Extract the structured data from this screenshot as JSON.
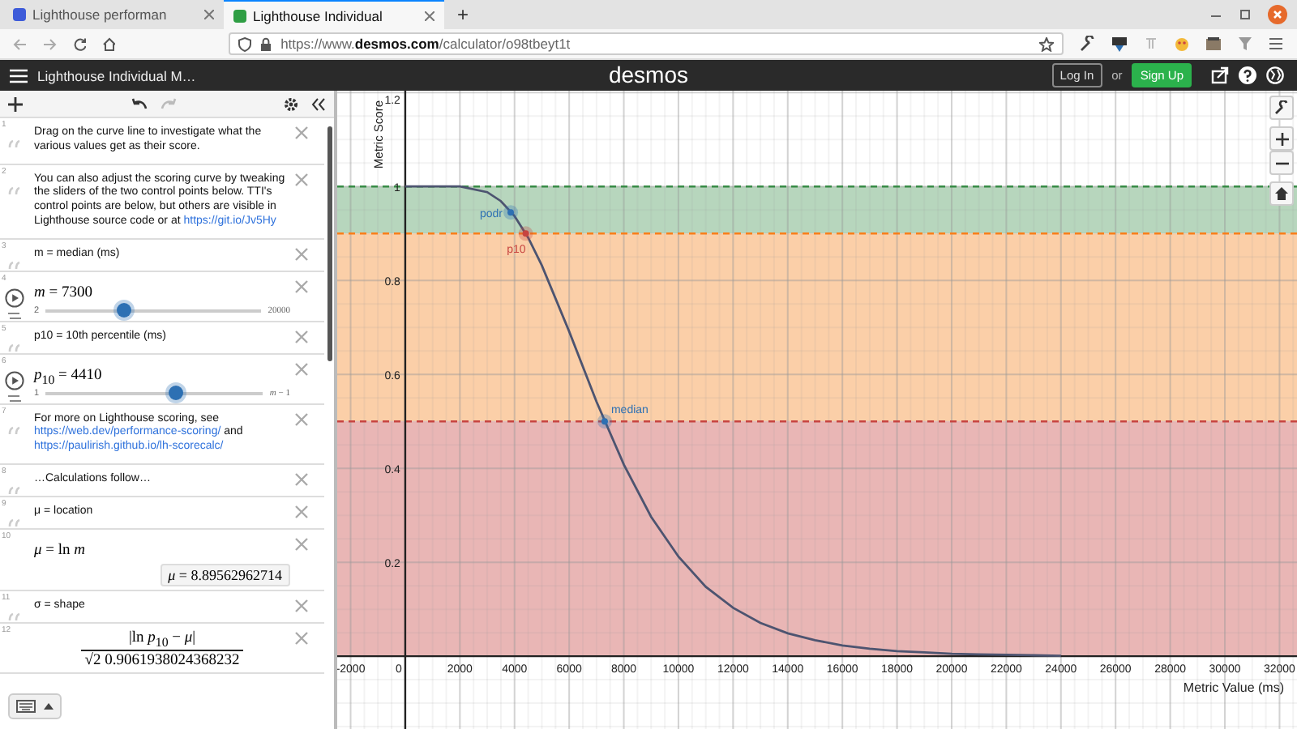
{
  "browser": {
    "tabs": [
      {
        "label": "Lighthouse performan",
        "selected": false
      },
      {
        "label": "Lighthouse Individual",
        "selected": true
      }
    ],
    "new_tab": "+",
    "url": "https://www.**desmos.com**/calculator/o98tbeyt1t"
  },
  "header": {
    "title": "Lighthouse Individual M…",
    "logo": "desmos",
    "login": "Log In",
    "or": "or",
    "signup": "Sign Up"
  },
  "expressions": [
    {
      "kind": "note",
      "number": "1",
      "parts": [
        {
          "text": "Drag on the curve line to investigate what the various values get as their score.",
          "kind": "text"
        }
      ]
    },
    {
      "kind": "note",
      "number": "2",
      "parts": [
        {
          "text": "You can also adjust the scoring curve by tweaking the sliders of the two control points below. TTI's control points are below, but others are visible in Lighthouse source code or at ",
          "kind": "text"
        },
        {
          "text": "https://git.io/Jv5Hy",
          "kind": "link"
        }
      ]
    },
    {
      "kind": "note",
      "number": "3",
      "parts": [
        {
          "text": "m = median (ms)",
          "kind": "text"
        }
      ]
    },
    {
      "kind": "slider",
      "number": "4",
      "expr": "*m* = 7300",
      "min": "2",
      "max": "20000",
      "level": 0.365
    },
    {
      "kind": "note",
      "number": "5",
      "parts": [
        {
          "text": "p10 = 10th percentile (ms)",
          "kind": "text"
        }
      ]
    },
    {
      "kind": "slider",
      "number": "6",
      "expr": "*p*$_{10}$ = 4410",
      "min": "1",
      "max": "*m* − 1",
      "level": 0.6
    },
    {
      "kind": "note",
      "number": "7",
      "parts": [
        {
          "text": "For more on Lighthouse scoring, see ",
          "kind": "text"
        },
        {
          "text": "https://web.dev/performance-scoring/",
          "kind": "link"
        },
        {
          "text": " and ",
          "kind": "text"
        },
        {
          "text": "https://paulirish.github.io/lh-scorecalc/",
          "kind": "link"
        }
      ]
    },
    {
      "kind": "note",
      "number": "8",
      "parts": [
        {
          "text": "…Calculations follow…",
          "kind": "text"
        }
      ]
    },
    {
      "kind": "note",
      "number": "9",
      "parts": [
        {
          "text": "μ = location",
          "kind": "text"
        }
      ]
    },
    {
      "kind": "expression",
      "number": "10",
      "expr": "*μ* = ln *m*",
      "result": "*μ* = 8.89562962714"
    },
    {
      "kind": "note",
      "number": "11",
      "parts": [
        {
          "text": "σ = shape",
          "kind": "text"
        }
      ]
    },
    {
      "kind": "fraction",
      "number": "12",
      "numerator": "|ln *p*$_{10}$ − *μ*|",
      "denominator": "√2 0.9061938024368232"
    }
  ],
  "graph": {
    "chart_data": {
      "type": "line",
      "xlabel": "Metric Value (ms)",
      "ylabel": "Metric Score",
      "x": [
        0,
        1000,
        2000,
        3000,
        3500,
        4000,
        4500,
        5000,
        6000,
        7000,
        8000,
        9000,
        10000,
        11000,
        12000,
        13000,
        14000,
        15000,
        16000,
        17000,
        18000,
        19000,
        20000,
        21000,
        22000,
        23000,
        24000
      ],
      "series": [
        {
          "color": "#4d5470",
          "values": [
            1,
            1,
            1,
            0.988,
            0.969,
            0.937,
            0.891,
            0.832,
            0.691,
            0.542,
            0.408,
            0.297,
            0.212,
            0.148,
            0.103,
            0.071,
            0.049,
            0.034,
            0.023,
            0.016,
            0.011,
            0.008,
            0.005,
            0.004,
            0.003,
            0.002,
            0.001
          ]
        }
      ],
      "xlim": [
        -2490,
        32640
      ],
      "ylim": [
        -0.155,
        1.204
      ],
      "xticks": [
        -2000,
        0,
        2000,
        4000,
        6000,
        8000,
        10000,
        12000,
        14000,
        16000,
        18000,
        20000,
        22000,
        24000,
        26000,
        28000,
        30000,
        32000
      ],
      "yticks": [
        0.2,
        0.4,
        0.6,
        0.8,
        1,
        1.2
      ],
      "grid": true,
      "bands": [
        {
          "axis": "y",
          "from": 0.9,
          "to": 1,
          "color": "#b7d6bd"
        },
        {
          "axis": "y",
          "from": 0.5,
          "to": 0.9,
          "color": "#fbcfa8"
        },
        {
          "axis": "y",
          "from": 0,
          "to": 0.5,
          "color": "#e9b6b5"
        }
      ],
      "ref_lines": [
        {
          "axis": "y",
          "value": 1,
          "color": "#388c46"
        },
        {
          "axis": "y",
          "value": 0.9,
          "color": "#fa7e19"
        },
        {
          "axis": "y",
          "value": 0.5,
          "color": "#c74440"
        }
      ],
      "annotations": [
        {
          "text": "podr",
          "x": 3860,
          "y": 0.945
        },
        {
          "text": "p10",
          "x": 4410,
          "y": 0.9
        },
        {
          "text": "median",
          "x": 7300,
          "y": 0.5
        }
      ]
    }
  }
}
